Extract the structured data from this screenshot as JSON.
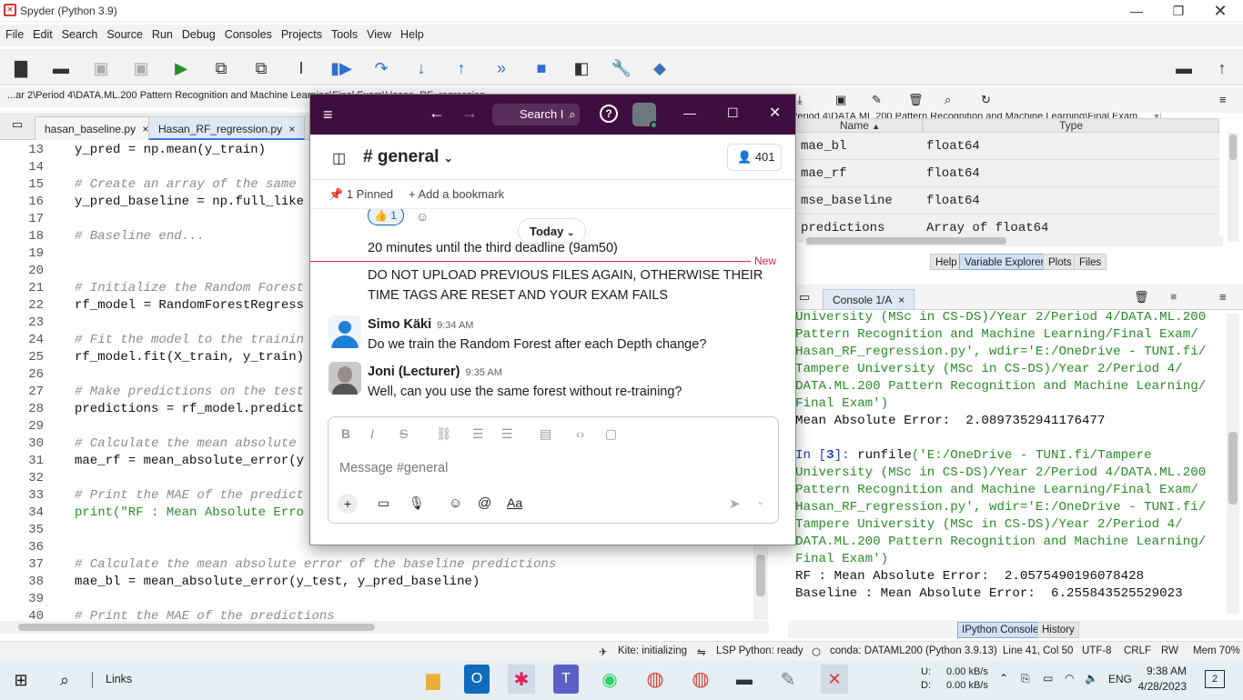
{
  "window": {
    "title": "Spyder (Python 3.9)",
    "logo": "spyder-logo"
  },
  "menu": [
    "File",
    "Edit",
    "Search",
    "Source",
    "Run",
    "Debug",
    "Consoles",
    "Projects",
    "Tools",
    "View",
    "Help"
  ],
  "toolbar": {
    "path": "MSc in CS-DS)\\Year 2\\Period 4\\DATA.ML.200 Pattern Recognition and Machine Learning\\Final Exam"
  },
  "pathbar": "...ar 2\\Period 4\\DATA.ML.200 Pattern Recognition and Machine Learning\\Final Exam\\Hasan_RF_regression",
  "editor": {
    "tabs": [
      {
        "label": "hasan_baseline.py",
        "close": "×"
      },
      {
        "label": "Hasan_RF_regression.py",
        "close": "×"
      }
    ],
    "lines": [
      {
        "n": "13",
        "code": "y_pred = np.mean(y_train)",
        "kind": "code"
      },
      {
        "n": "14",
        "code": "",
        "kind": "code"
      },
      {
        "n": "15",
        "code": "# Create an array of the same",
        "kind": "comment"
      },
      {
        "n": "16",
        "code": "y_pred_baseline = np.full_like",
        "kind": "code"
      },
      {
        "n": "17",
        "code": "",
        "kind": "code"
      },
      {
        "n": "18",
        "code": "# Baseline end...",
        "kind": "comment"
      },
      {
        "n": "19",
        "code": "",
        "kind": "code"
      },
      {
        "n": "20",
        "code": "",
        "kind": "code"
      },
      {
        "n": "21",
        "code": "# Initialize the Random Forest",
        "kind": "comment"
      },
      {
        "n": "22",
        "code": "rf_model = RandomForestRegress",
        "kind": "code"
      },
      {
        "n": "23",
        "code": "",
        "kind": "code"
      },
      {
        "n": "24",
        "code": "# Fit the model to the trainin",
        "kind": "comment"
      },
      {
        "n": "25",
        "code": "rf_model.fit(X_train, y_train)",
        "kind": "code"
      },
      {
        "n": "26",
        "code": "",
        "kind": "code"
      },
      {
        "n": "27",
        "code": "# Make predictions on the test",
        "kind": "comment"
      },
      {
        "n": "28",
        "code": "predictions = rf_model.predict",
        "kind": "code"
      },
      {
        "n": "29",
        "code": "",
        "kind": "code"
      },
      {
        "n": "30",
        "code": "# Calculate the mean absolute",
        "kind": "comment"
      },
      {
        "n": "31",
        "code": "mae_rf = mean_absolute_error(y",
        "kind": "code"
      },
      {
        "n": "32",
        "code": "",
        "kind": "code"
      },
      {
        "n": "33",
        "code": "# Print the MAE of the predict",
        "kind": "comment"
      },
      {
        "n": "34",
        "code": "print(\"RF : Mean Absolute Erro",
        "kind": "print"
      },
      {
        "n": "35",
        "code": "",
        "kind": "code"
      },
      {
        "n": "36",
        "code": "",
        "kind": "code"
      },
      {
        "n": "37",
        "code": "# Calculate the mean absolute error of the baseline predictions",
        "kind": "comment"
      },
      {
        "n": "38",
        "code": "mae_bl = mean_absolute_error(y_test, y_pred_baseline)",
        "kind": "code"
      },
      {
        "n": "39",
        "code": "",
        "kind": "code"
      },
      {
        "n": "40",
        "code": "# Print the MAE of the predictions",
        "kind": "comment"
      }
    ]
  },
  "variables": {
    "col_name": "Name",
    "col_type": "Type",
    "rows": [
      {
        "name": "mae_bl",
        "type": "float64"
      },
      {
        "name": "mae_rf",
        "type": "float64"
      },
      {
        "name": "mse_baseline",
        "type": "float64"
      },
      {
        "name": "predictions",
        "type": "Array of float64"
      }
    ],
    "tabs": [
      "Help",
      "Variable Explorer",
      "Plots",
      "Files"
    ]
  },
  "console": {
    "tab": "Console 1/A",
    "lines": [
      {
        "t": "University (MSc in CS-DS)/Year 2/Period 4/DATA.ML.200",
        "c": "green"
      },
      {
        "t": "Pattern Recognition and Machine Learning/Final Exam/",
        "c": "green"
      },
      {
        "t": "Hasan_RF_regression.py', wdir='E:/OneDrive - TUNI.fi/",
        "c": "green"
      },
      {
        "t": "Tampere University (MSc in CS-DS)/Year 2/Period 4/",
        "c": "green"
      },
      {
        "t": "DATA.ML.200 Pattern Recognition and Machine Learning/",
        "c": "green"
      },
      {
        "t": "Final Exam')",
        "c": "green"
      },
      {
        "t": "Mean Absolute Error:  2.0897352941176477",
        "c": "black"
      },
      {
        "t": "",
        "c": "black"
      },
      {
        "t": "In [3]: runfile('E:/OneDrive - TUNI.fi/Tampere",
        "c": "prompt"
      },
      {
        "t": "University (MSc in CS-DS)/Year 2/Period 4/DATA.ML.200",
        "c": "green"
      },
      {
        "t": "Pattern Recognition and Machine Learning/Final Exam/",
        "c": "green"
      },
      {
        "t": "Hasan_RF_regression.py', wdir='E:/OneDrive - TUNI.fi/",
        "c": "green"
      },
      {
        "t": "Tampere University (MSc in CS-DS)/Year 2/Period 4/",
        "c": "green"
      },
      {
        "t": "DATA.ML.200 Pattern Recognition and Machine Learning/",
        "c": "green"
      },
      {
        "t": "Final Exam')",
        "c": "green"
      },
      {
        "t": "RF : Mean Absolute Error:  2.0575490196078428",
        "c": "black"
      },
      {
        "t": "Baseline : Mean Absolute Error:  6.255843525529023",
        "c": "black"
      }
    ],
    "bottom_tabs": [
      "IPython Console",
      "History"
    ]
  },
  "status": {
    "kite": "Kite: initializing",
    "lsp": "LSP Python: ready",
    "conda": "conda: DATAML200 (Python 3.9.13)",
    "pos": "Line 41, Col 50",
    "enc": "UTF-8",
    "eol": "CRLF",
    "rw": "RW",
    "mem": "Mem 70%"
  },
  "taskbar": {
    "links": "Links",
    "net_u_label": "U:",
    "net_d_label": "D:",
    "net_u": "0.00 kB/s",
    "net_d": "0.00 kB/s",
    "lang": "ENG",
    "time": "9:38 AM",
    "date": "4/28/2023",
    "notif": "2"
  },
  "slack": {
    "search": "Search I",
    "channel": "# general",
    "members": "401",
    "pinned": "1 Pinned",
    "bookmark": "Add a bookmark",
    "today": "Today",
    "reaction_count": "1",
    "new_label": "New",
    "messages": [
      {
        "text": "20 minutes until the third deadline (9am50)"
      },
      {
        "text": "DO NOT UPLOAD PREVIOUS FILES AGAIN, OTHERWISE THEIR TIME TAGS ARE RESET AND YOUR EXAM FAILS"
      }
    ],
    "posts": [
      {
        "author": "Simo Käki",
        "time": "9:34 AM",
        "text": "Do we train the Random Forest after each Depth change?"
      },
      {
        "author": "Joni (Lecturer)",
        "time": "9:35 AM",
        "text": "Well, can you use the same forest without re-training?"
      }
    ],
    "composer_placeholder": "Message #general",
    "composer_aa": "Aa"
  },
  "colors": {
    "slack_header": "#3f0e40",
    "accent": "#3b7bd4",
    "code_green": "#2a8a2a",
    "new_red": "#e01e5a"
  }
}
